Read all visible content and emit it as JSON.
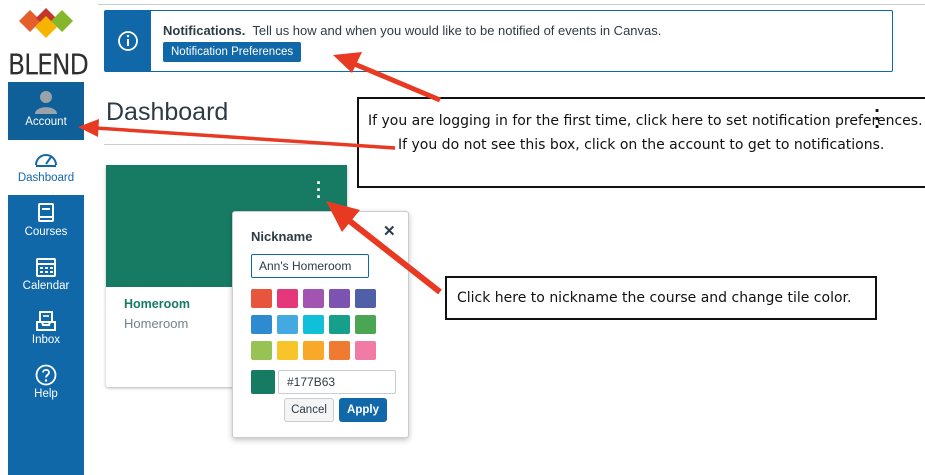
{
  "brand": {
    "wordmark": "BLEND",
    "colors": [
      "#e55f2d",
      "#c3362b",
      "#f6b400",
      "#86b72b"
    ]
  },
  "sidebar": {
    "items": [
      {
        "label": "Account",
        "icon": "user-avatar-icon"
      },
      {
        "label": "Dashboard",
        "icon": "dashboard-gauge-icon"
      },
      {
        "label": "Courses",
        "icon": "courses-book-icon"
      },
      {
        "label": "Calendar",
        "icon": "calendar-icon"
      },
      {
        "label": "Inbox",
        "icon": "inbox-tray-icon"
      },
      {
        "label": "Help",
        "icon": "help-question-icon"
      }
    ],
    "accent": "#1168a8"
  },
  "notification": {
    "title": "Notifications.",
    "text": "Tell us how and when you would like to be notified of events in Canvas.",
    "button": "Notification Preferences",
    "icon": "info-circle-icon"
  },
  "page": {
    "title": "Dashboard"
  },
  "callouts": {
    "first_line": "If you are logging in for the first time, click here to set notification preferences.",
    "second_line": "If you do not see this box, click on the account to get to notifications.",
    "tile_note": "Click here to nickname the course and change tile color."
  },
  "course_card": {
    "name": "Homeroom",
    "subtitle": "Homeroom",
    "color": "#177B63",
    "menu_icon": "kebab-menu-icon"
  },
  "nickname_popover": {
    "title": "Nickname",
    "close_icon": "close-x-icon",
    "value": "Ann's Homeroom",
    "swatches": [
      "#e8553d",
      "#e5387a",
      "#a255b0",
      "#7c53b0",
      "#5060a8",
      "#2e8bd0",
      "#45a9e1",
      "#10bfd8",
      "#16a08a",
      "#4aa653",
      "#97c355",
      "#f7c52a",
      "#f8a928",
      "#ef7a31",
      "#f07ca6"
    ],
    "hex_value": "#177B63",
    "cancel": "Cancel",
    "apply": "Apply"
  },
  "arrow_color": "#e83a23"
}
